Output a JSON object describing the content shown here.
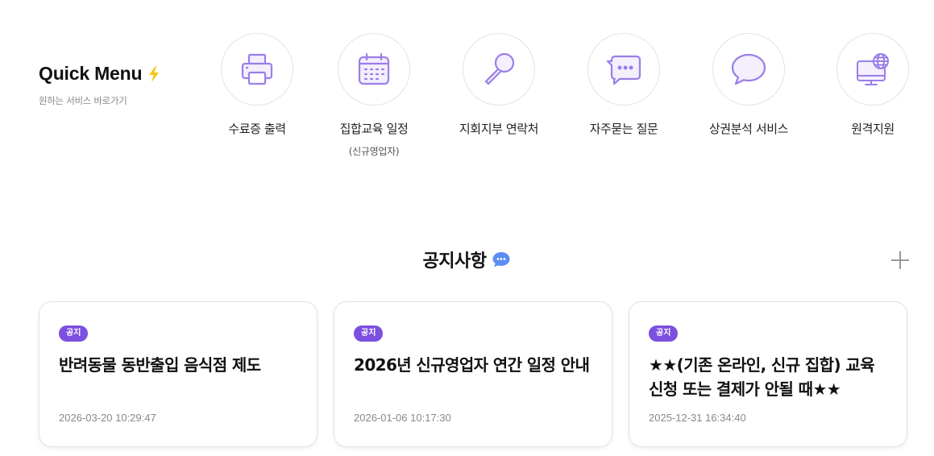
{
  "quick_menu": {
    "title": "Quick Menu",
    "subtitle": "원하는 서비스 바로가기",
    "accent_color": "#9b7ee8",
    "items": [
      {
        "label": "수료증 출력",
        "icon": "printer-icon"
      },
      {
        "label": "집합교육 일정",
        "note": "(신규영업자)",
        "icon": "calendar-icon"
      },
      {
        "label": "지회지부 연락처",
        "icon": "magnifier-icon"
      },
      {
        "label": "자주묻는 질문",
        "icon": "chat-bubble-dots-icon"
      },
      {
        "label": "상권분석 서비스",
        "icon": "speech-bubble-icon"
      },
      {
        "label": "원격지원",
        "icon": "monitor-globe-icon"
      }
    ]
  },
  "notice": {
    "title": "공지사항",
    "more_icon": "plus-icon",
    "badge_color": "#7b4fe0",
    "cards": [
      {
        "badge": "공지",
        "title": "반려동물 동반출입 음식점 제도",
        "date": "2026-03-20 10:29:47"
      },
      {
        "badge": "공지",
        "title": "2026년 신규영업자 연간 일정 안내",
        "date": "2026-01-06 10:17:30"
      },
      {
        "badge": "공지",
        "title": "★★(기존 온라인, 신규 집합) 교육 신청 또는 결제가 안될 때★★",
        "date": "2025-12-31 16:34:40"
      }
    ]
  }
}
